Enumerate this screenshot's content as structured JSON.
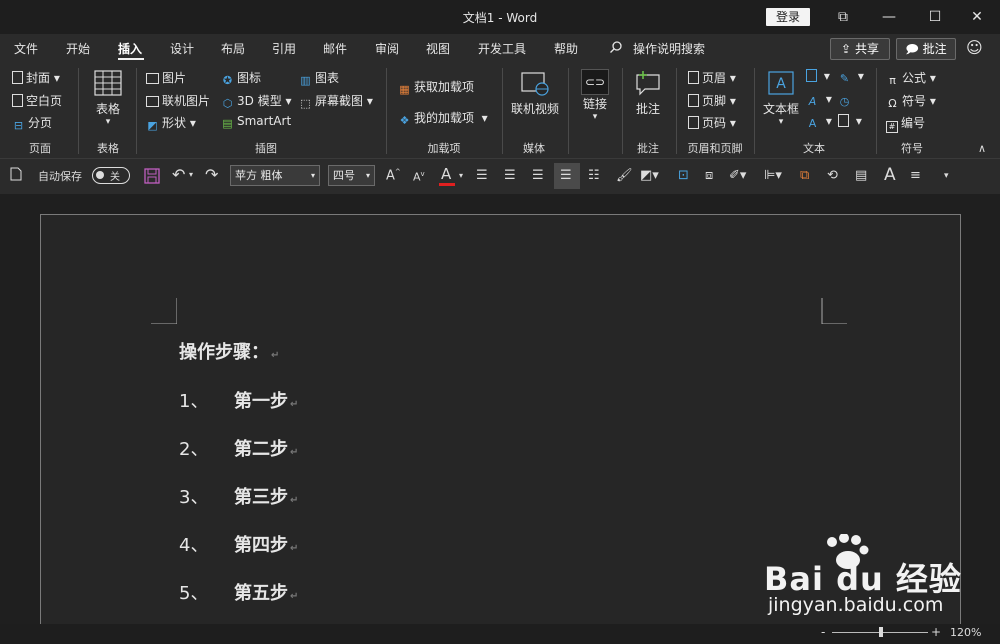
{
  "window": {
    "title": "文档1  -  Word",
    "login_label": "登录",
    "controls": [
      "⧉",
      "—",
      "☐",
      "✕"
    ]
  },
  "menu": {
    "tabs": [
      "文件",
      "开始",
      "插入",
      "设计",
      "布局",
      "引用",
      "邮件",
      "审阅",
      "视图",
      "开发工具",
      "帮助"
    ],
    "active_tab": "插入",
    "search_label": "操作说明搜索",
    "share_label": "共享",
    "comment_label": "批注"
  },
  "ribbon": {
    "pages": {
      "items": [
        "封面",
        "空白页",
        "分页"
      ],
      "label": "页面"
    },
    "table": {
      "button": "表格",
      "label": "表格"
    },
    "illustrations": {
      "items": [
        "图片",
        "联机图片",
        "形状",
        "图标",
        "3D 模型",
        "SmartArt",
        "图表",
        "屏幕截图"
      ],
      "label": "插图"
    },
    "addins": {
      "items": [
        "获取加载项",
        "我的加载项"
      ],
      "label": "加载项"
    },
    "media": {
      "button": "联机视频",
      "label": "媒体"
    },
    "links": {
      "button": "链接"
    },
    "comments": {
      "button": "批注",
      "label": "批注"
    },
    "header_footer": {
      "items": [
        "页眉",
        "页脚",
        "页码"
      ],
      "label": "页眉和页脚"
    },
    "text": {
      "button": "文本框",
      "label": "文本"
    },
    "symbols": {
      "items": [
        "公式",
        "符号",
        "编号"
      ],
      "label": "符号"
    }
  },
  "qat": {
    "autosave_label": "自动保存",
    "autosave_state": "关",
    "font_name": "苹方 粗体",
    "font_size": "四号"
  },
  "document": {
    "heading": "操作步骤：",
    "items": [
      {
        "num": "1、",
        "text": "第一步"
      },
      {
        "num": "2、",
        "text": "第二步"
      },
      {
        "num": "3、",
        "text": "第三步"
      },
      {
        "num": "4、",
        "text": "第四步"
      },
      {
        "num": "5、",
        "text": "第五步"
      }
    ]
  },
  "status": {
    "zoom": "120%",
    "zoom_minus": "-",
    "zoom_plus": "+"
  },
  "watermark": {
    "brand": "Bai du 经验",
    "url": "jingyan.baidu.com"
  },
  "colors": {
    "accent_red": "#e23b3b",
    "font_color_bar": "#e02020",
    "link_blue": "#4aa3e0"
  }
}
